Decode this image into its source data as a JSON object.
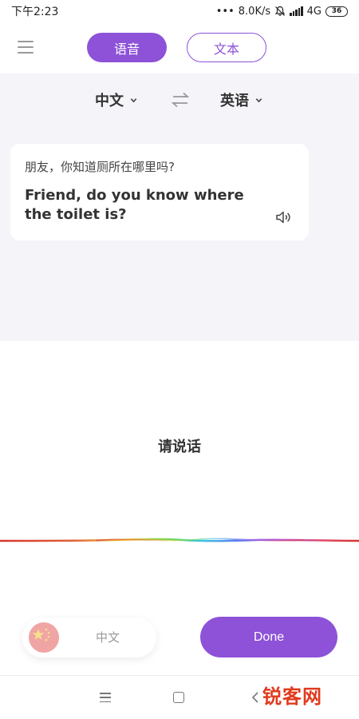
{
  "status_bar": {
    "time": "下午2:23",
    "network_speed": "8.0K/s",
    "dots": "•••",
    "network_type": "4G",
    "battery": "36"
  },
  "header": {
    "tabs": [
      {
        "label": "语音",
        "active": true
      },
      {
        "label": "文本",
        "active": false
      }
    ]
  },
  "languages": {
    "source": "中文",
    "target": "英语"
  },
  "translation_card": {
    "source_text": "朋友，你知道厕所在哪里吗?",
    "translated_text": "Friend, do you know where the toilet is?"
  },
  "prompt": "请说话",
  "bottom": {
    "language_pill": "中文",
    "done_label": "Done"
  },
  "watermark": "锐客网",
  "colors": {
    "accent": "#8d52d8",
    "background_grey": "#f5f4f9"
  }
}
